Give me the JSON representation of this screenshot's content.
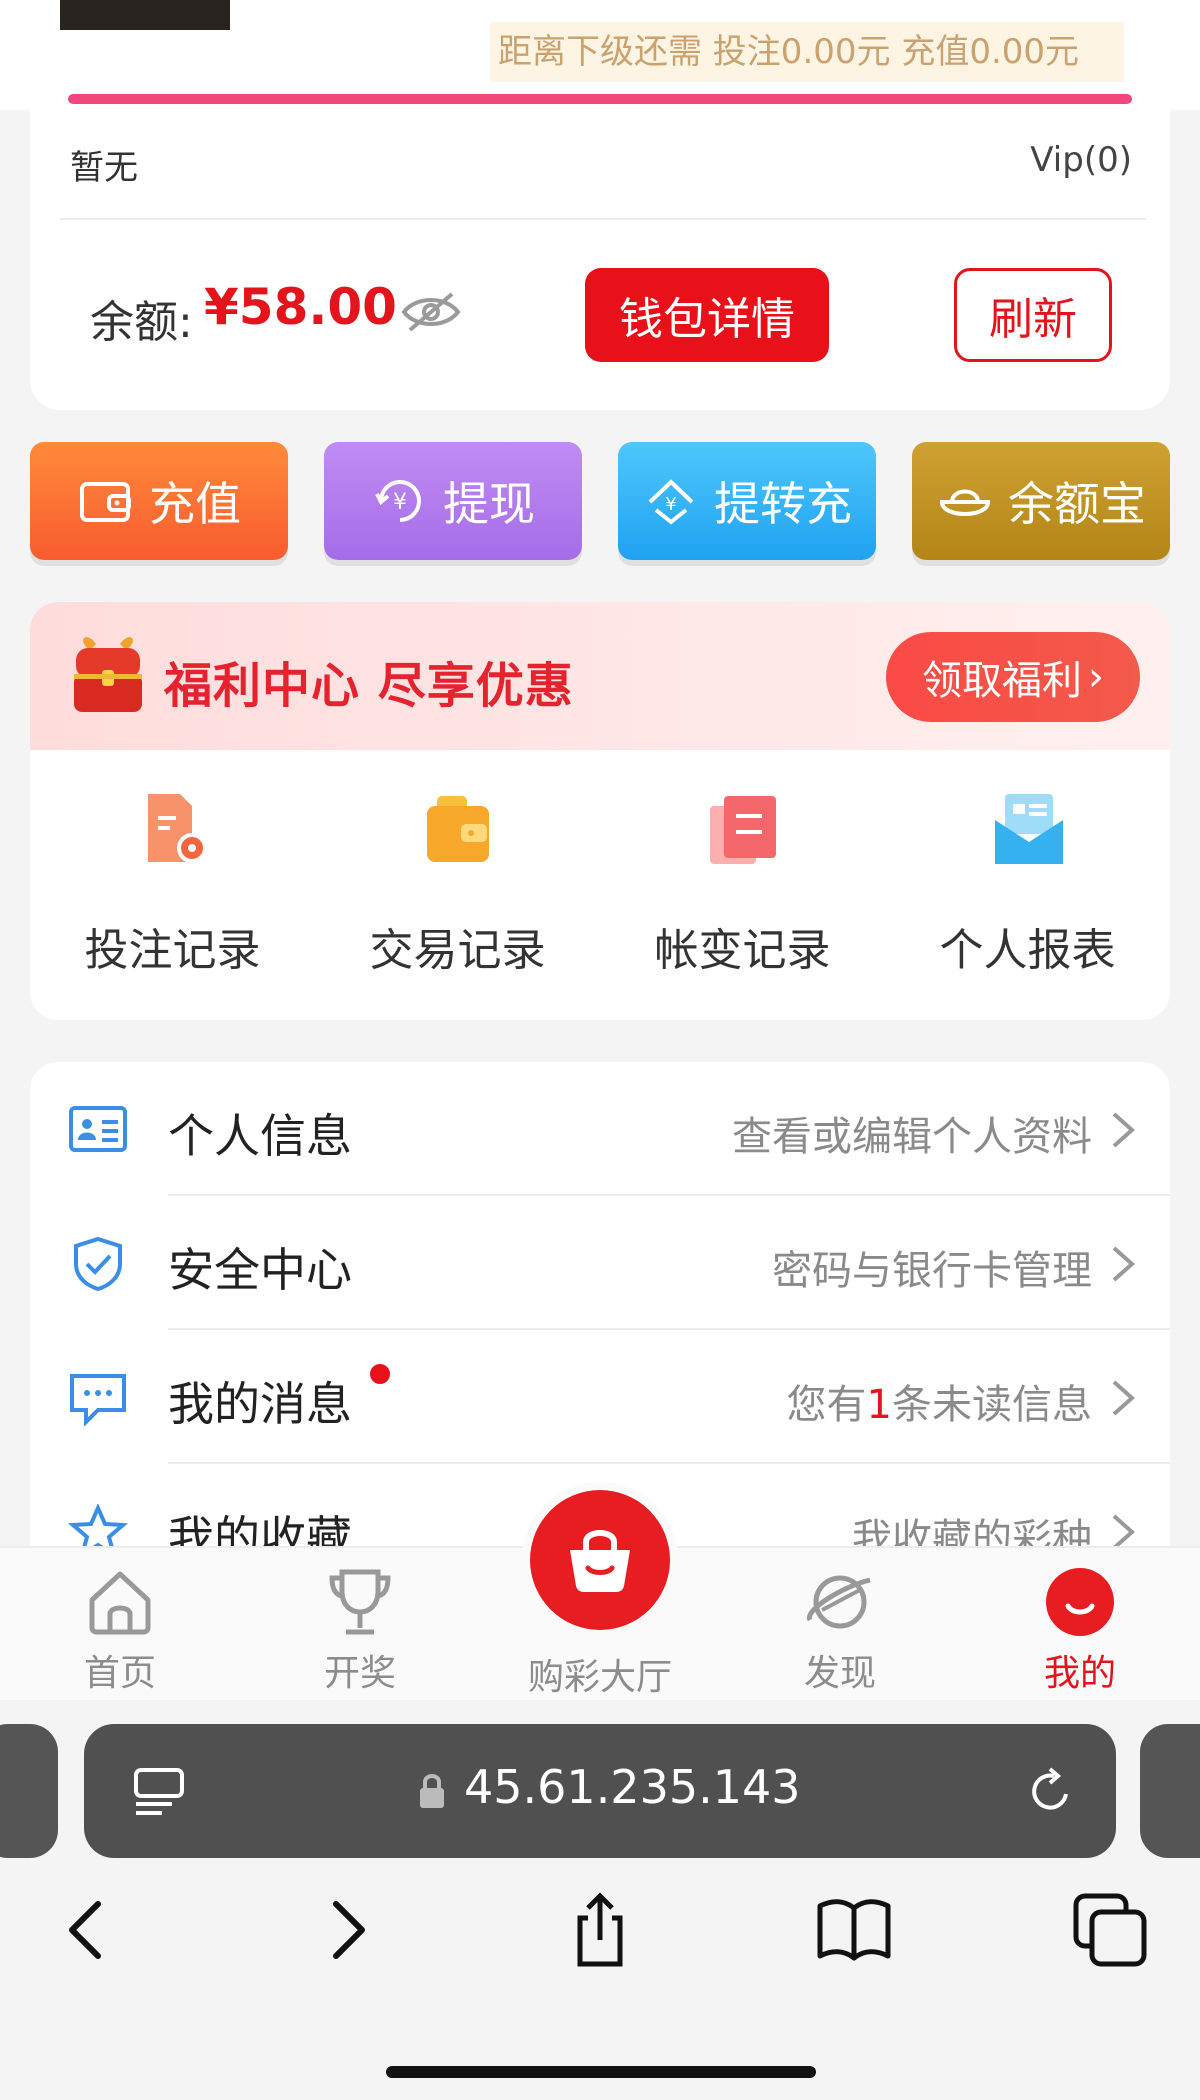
{
  "vip": {
    "next_level_text": "距离下级还需  投注0.00元  充值0.00元",
    "level_left": "暂无",
    "level_right": "Vip(0)",
    "progress": 1.0
  },
  "balance": {
    "label": "余额:",
    "amount": "¥58.00",
    "wallet_button": "钱包详情",
    "refresh_button": "刷新"
  },
  "actions": [
    {
      "label": "充值",
      "icon": "wallet-icon",
      "color": "#f8702f"
    },
    {
      "label": "提现",
      "icon": "withdraw-icon",
      "color": "#b07cee"
    },
    {
      "label": "提转充",
      "icon": "transfer-icon",
      "color": "#2fb0f6"
    },
    {
      "label": "余额宝",
      "icon": "ingot-icon",
      "color": "#c2921f"
    }
  ],
  "welfare": {
    "title": "福利中心 尽享优惠",
    "button": "领取福利"
  },
  "records": [
    {
      "label": "投注记录",
      "icon": "bet-record-icon"
    },
    {
      "label": "交易记录",
      "icon": "trade-record-icon"
    },
    {
      "label": "帐变记录",
      "icon": "account-change-icon"
    },
    {
      "label": "个人报表",
      "icon": "report-icon"
    }
  ],
  "menu": [
    {
      "title": "个人信息",
      "subtitle": "查看或编辑个人资料",
      "icon": "id-card-icon"
    },
    {
      "title": "安全中心",
      "subtitle": "密码与银行卡管理",
      "icon": "shield-icon"
    },
    {
      "title": "我的消息",
      "subtitle_prefix": "您有",
      "subtitle_count": "1",
      "subtitle_suffix": "条未读信息",
      "icon": "message-icon"
    },
    {
      "title": "我的收藏",
      "subtitle": "我收藏的彩种",
      "icon": "star-icon"
    }
  ],
  "tabbar": {
    "home": "首页",
    "lottery_results": "开奖",
    "hall": "购彩大厅",
    "discover": "发现",
    "mine": "我的",
    "active": "mine"
  },
  "browser": {
    "url": "45.61.235.143"
  },
  "colors": {
    "accent_red": "#e3141b",
    "vip_bar": "#f2477d",
    "muted_text": "#8a8a8a"
  }
}
